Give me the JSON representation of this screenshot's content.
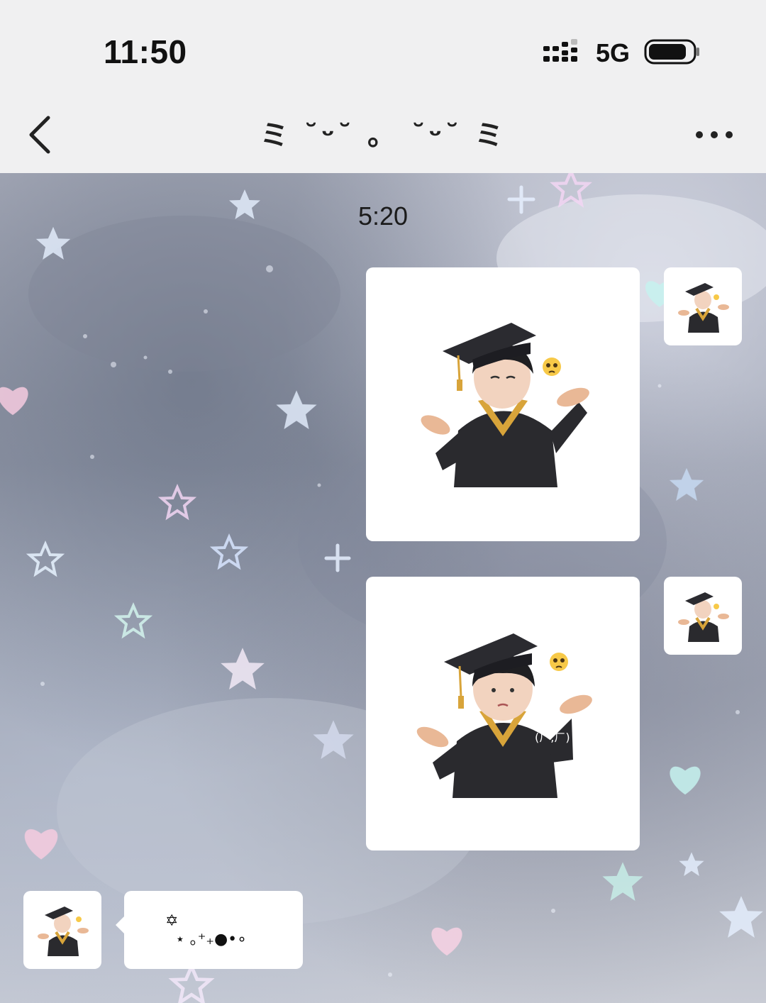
{
  "status_bar": {
    "time": "11:50",
    "network": "5G",
    "icons": [
      "signal-icon",
      "battery-icon"
    ]
  },
  "nav": {
    "title": "ミ  ˘ᵕ˘  。 ˘ᵕ˘ ミ",
    "back_icon": "chevron-left-icon",
    "more_icon": "more-dots-icon"
  },
  "chat": {
    "timestamp": "5:20",
    "messages": [
      {
        "side": "right",
        "type": "sticker",
        "content": "graduation-boy-shrug-sticker",
        "sticker_emoji": "🥺"
      },
      {
        "side": "right",
        "type": "sticker",
        "content": "graduation-boy-shrug-sticker",
        "sticker_emoji": "🥺",
        "sticker_text": "(ㄏ,ㄏ)"
      },
      {
        "side": "left",
        "type": "text",
        "text": "✡\n  ⋆ ｡⁺₊●•∘"
      }
    ],
    "background_colors": {
      "cloud": "#9aa0b0",
      "star_tint": "#e9f2ff",
      "heart_pink": "#f4c6dc",
      "heart_cyan": "#bff0ee"
    }
  }
}
